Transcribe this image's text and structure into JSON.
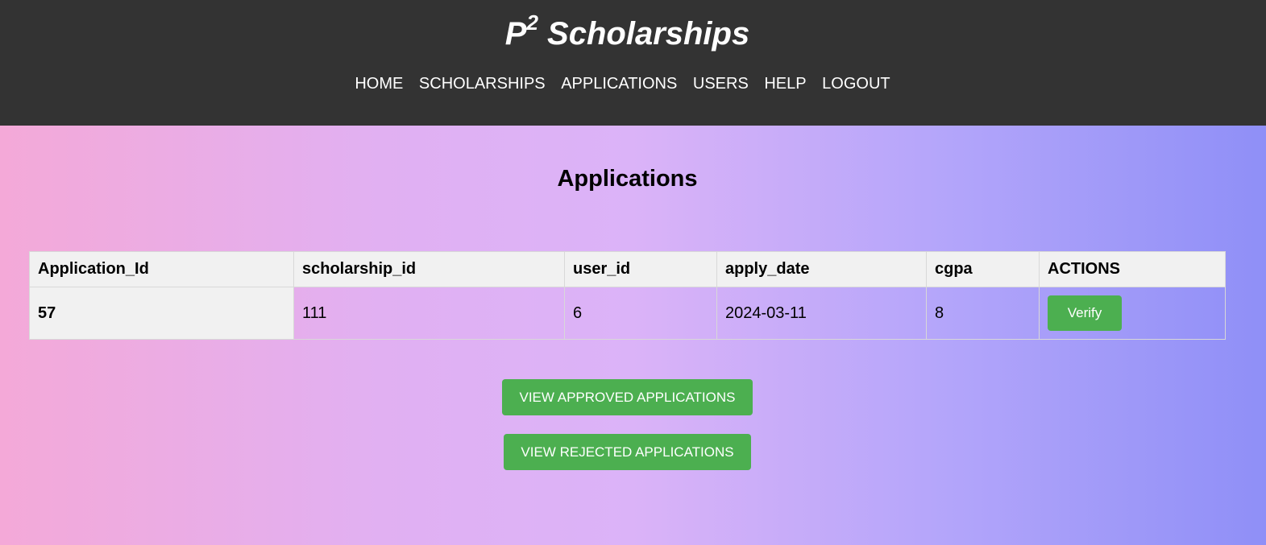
{
  "header": {
    "title_main": "P",
    "title_sup": "2",
    "title_rest": " Scholarships",
    "nav": [
      "HOME",
      "SCHOLARSHIPS",
      "APPLICATIONS",
      "USERS",
      "HELP",
      "LOGOUT"
    ]
  },
  "main": {
    "title": "Applications",
    "table": {
      "headers": [
        "Application_Id",
        "scholarship_id",
        "user_id",
        "apply_date",
        "cgpa",
        "ACTIONS"
      ],
      "rows": [
        {
          "application_id": "57",
          "scholarship_id": "111",
          "user_id": "6",
          "apply_date": "2024-03-11",
          "cgpa": "8",
          "action_label": "Verify"
        }
      ]
    },
    "buttons": {
      "approved": "VIEW APPROVED APPLICATIONS",
      "rejected": "VIEW REJECTED APPLICATIONS"
    }
  },
  "colors": {
    "header_bg": "#333333",
    "button_green": "#4caf50",
    "gradient_start": "#f4a9d8",
    "gradient_end": "#8f8ff7"
  }
}
